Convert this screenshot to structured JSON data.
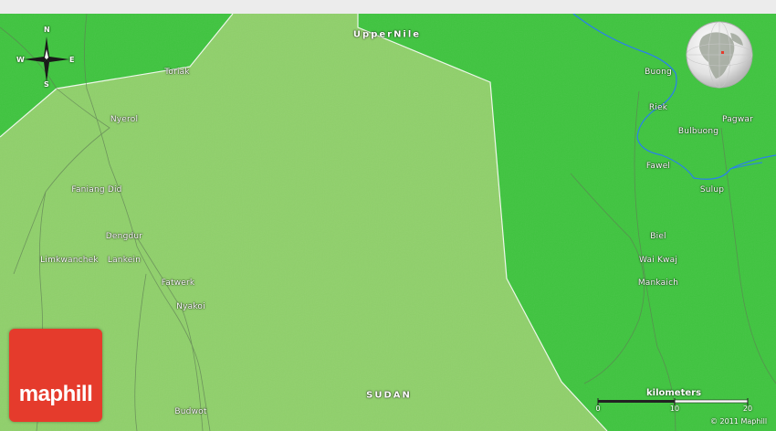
{
  "map": {
    "regions": {
      "upper_nile": "UpperNile",
      "sudan": "SUDAN"
    },
    "places": {
      "toriak": "Toriak",
      "nyerol": "Nyerol",
      "faniang_did": "Faniang Did",
      "dengdur": "Dengdur",
      "limkwanchek": "Limkwanchek",
      "lankein": "Lankein",
      "fatwerk": "Fatwerk",
      "nyakoi": "Nyakoi",
      "budwot": "Budwot",
      "buong": "Buong",
      "riek": "Riek",
      "bulbuong": "Bulbuong",
      "pagwar": "Pagwar",
      "fawel": "Fawel",
      "sulup": "Sulup",
      "biel": "Biel",
      "wai_kwaj": "Wai Kwaj",
      "mankaich": "Mankaich"
    },
    "compass": {
      "n": "N",
      "s": "S",
      "e": "E",
      "w": "W"
    },
    "scale": {
      "title": "kilometers",
      "ticks": [
        "0",
        "10",
        "20"
      ]
    },
    "brand": "maphill",
    "copyright": "© 2011 Maphill",
    "colors": {
      "land_dark": "#3ec43e",
      "land_light": "#8fd06a",
      "river": "#2a7ff0",
      "logo": "#e53b2c"
    }
  }
}
